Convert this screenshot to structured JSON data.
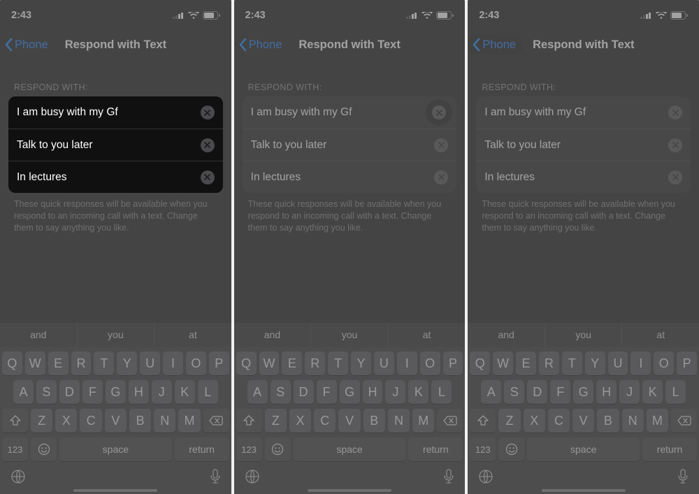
{
  "status": {
    "time": "2:43"
  },
  "nav": {
    "back": "Phone",
    "title": "Respond with Text"
  },
  "section": {
    "header": "RESPOND WITH:",
    "rows": [
      "I am busy with my Gf",
      "Talk to you later",
      "In lectures"
    ],
    "footer": "These quick responses will be available when you respond to an incoming call with a text. Change them to say anything you like."
  },
  "keyboard": {
    "suggest": [
      "and",
      "you",
      "at"
    ],
    "row1": [
      "Q",
      "W",
      "E",
      "R",
      "T",
      "Y",
      "U",
      "I",
      "O",
      "P"
    ],
    "row2": [
      "A",
      "S",
      "D",
      "F",
      "G",
      "H",
      "J",
      "K",
      "L"
    ],
    "row3": [
      "Z",
      "X",
      "C",
      "V",
      "B",
      "N",
      "M"
    ],
    "num": "123",
    "space": "space",
    "ret": "return"
  }
}
